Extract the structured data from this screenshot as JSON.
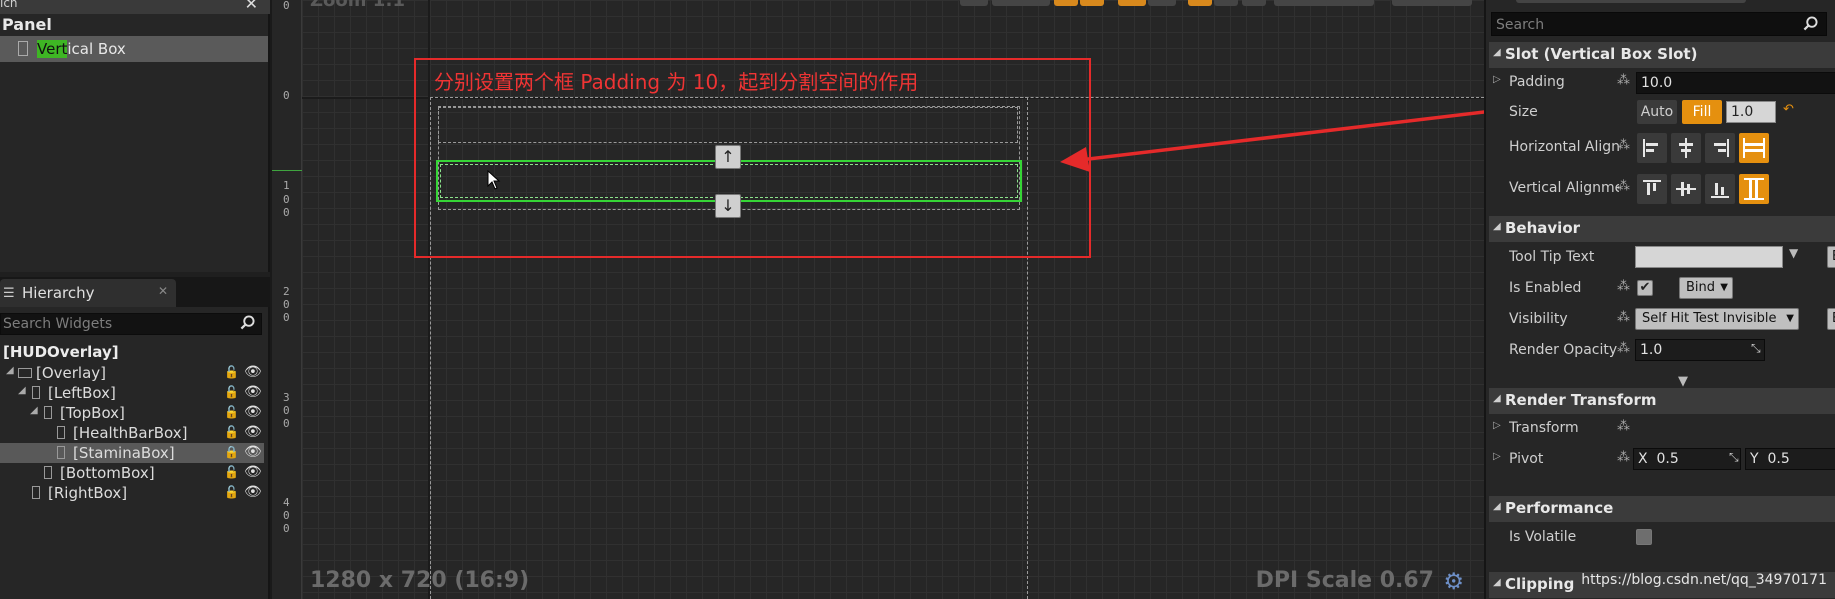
{
  "palette": {
    "search_fragment": "ich",
    "heading": "Panel",
    "item": {
      "label_highlight": "Vert",
      "label_rest": "ical Box"
    }
  },
  "hierarchy": {
    "tab_label": "Hierarchy",
    "search_placeholder": "Search Widgets",
    "root": "[HUDOverlay]",
    "nodes": [
      {
        "label": "[Overlay]",
        "depth": 0
      },
      {
        "label": "[LeftBox]",
        "depth": 1
      },
      {
        "label": "[TopBox]",
        "depth": 2
      },
      {
        "label": "[HealthBarBox]",
        "depth": 3
      },
      {
        "label": "[StaminaBox]",
        "depth": 3,
        "selected": true
      },
      {
        "label": "[BottomBox]",
        "depth": 2
      },
      {
        "label": "[RightBox]",
        "depth": 1
      }
    ]
  },
  "ruler": {
    "ticks": [
      "0",
      "0",
      "1",
      "0",
      "0",
      "2",
      "0",
      "0",
      "3",
      "0",
      "0",
      "4",
      "0",
      "0"
    ]
  },
  "canvas": {
    "zoom_label": "Zoom 1:1",
    "annotation": "分别设置两个框 Padding 为 10，起到分割空间的作用",
    "move_up": "↑",
    "move_down": "↓",
    "resolution": "1280 x 720 (16:9)",
    "dpi_scale": "DPI Scale 0.67"
  },
  "details": {
    "search_placeholder": "Search",
    "sections": {
      "slot": "Slot (Vertical Box Slot)",
      "behavior": "Behavior",
      "render_transform": "Render Transform",
      "performance": "Performance",
      "clipping": "Clipping"
    },
    "slot": {
      "padding_label": "Padding",
      "padding_value": "10.0",
      "size_label": "Size",
      "size_auto": "Auto",
      "size_fill": "Fill",
      "size_value": "1.0",
      "halign_label": "Horizontal Alignment",
      "valign_label": "Vertical Alignment"
    },
    "behavior": {
      "tooltip_label": "Tool Tip Text",
      "tooltip_value": "",
      "enabled_label": "Is Enabled",
      "bind_label": "Bind",
      "visibility_label": "Visibility",
      "visibility_value": "Self Hit Test Invisible",
      "opacity_label": "Render Opacity",
      "opacity_value": "1.0",
      "edge_btn": "B"
    },
    "render_transform": {
      "transform_label": "Transform",
      "pivot_label": "Pivot",
      "pivot_x_prefix": "X",
      "pivot_x": "0.5",
      "pivot_y_prefix": "Y",
      "pivot_y": "0.5"
    },
    "performance": {
      "volatile_label": "Is Volatile"
    }
  },
  "watermark": "https://blog.csdn.net/qq_34970171",
  "colors": {
    "accent_orange": "#e5900f",
    "selection_green": "#36d636",
    "annotation_red": "#e52a2a"
  }
}
